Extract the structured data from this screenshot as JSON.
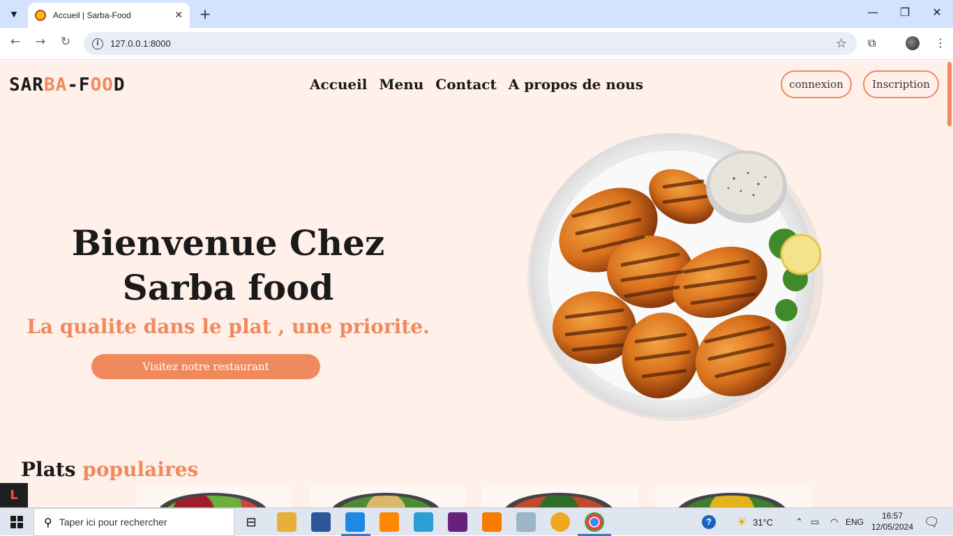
{
  "browser": {
    "tab_title": "Accueil | Sarba-Food",
    "tab_close": "✕",
    "new_tab": "+",
    "url": "127.0.0.1:8000",
    "minimize": "—",
    "restore": "❐",
    "close": "✕"
  },
  "site": {
    "logo_part1": "SAR",
    "logo_part2": "BA",
    "logo_part3": "-F",
    "logo_part4": "OO",
    "logo_part5": "D",
    "nav": [
      "Accueil",
      "Menu",
      "Contact",
      "A propos de nous"
    ],
    "login": "connexion",
    "register": "Inscription",
    "hero_title": "Bienvenue Chez Sarba food",
    "hero_subtitle": "La qualite dans le plat , une priorite.",
    "hero_button": "Visitez notre restaurant",
    "popular_part1": "Plats",
    "popular_part2": "populaires",
    "accent_color": "#f08a5d",
    "background_color": "#fff0ea"
  },
  "taskbar": {
    "search_placeholder": "Taper ici pour rechercher",
    "weather": "31°C",
    "lang": "ENG",
    "time": "16:57",
    "date": "12/05/2024"
  }
}
